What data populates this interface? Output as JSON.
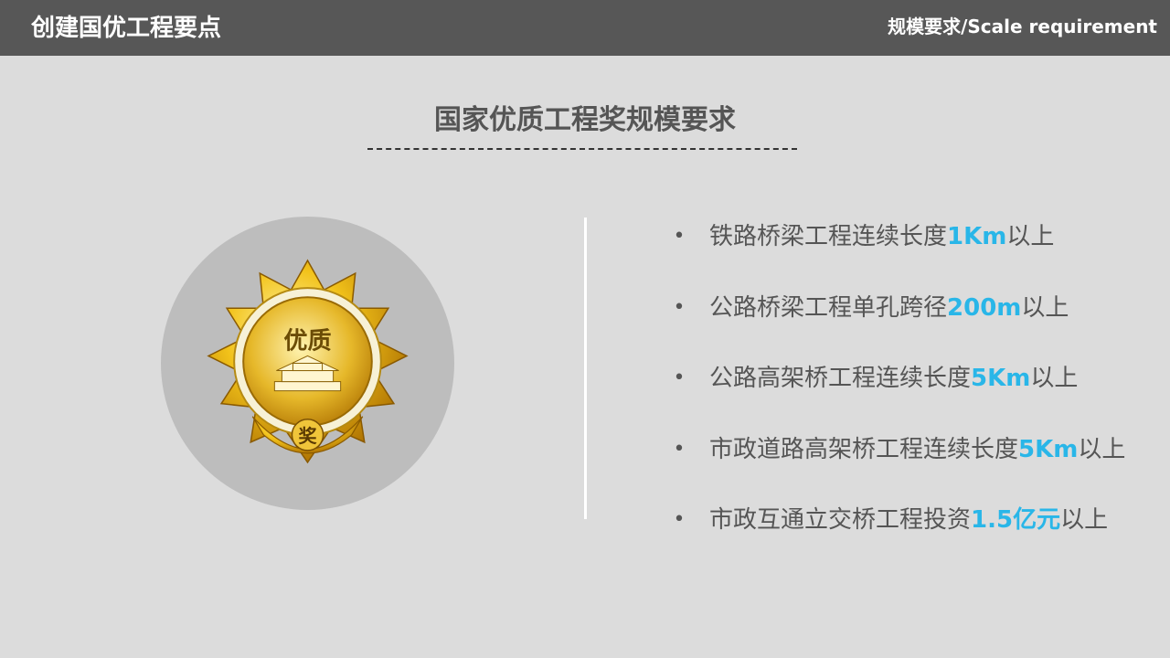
{
  "header": {
    "section_title": "创建国优工程要点",
    "page_label": "规模要求/Scale requirement"
  },
  "heading": "国家优质工程奖规模要求",
  "medal": {
    "top_text": "优质",
    "bottom_text": "奖",
    "icon": "gold-medal-icon"
  },
  "colors": {
    "highlight": "#29b6e8",
    "header_bg": "#575757",
    "background": "#dcdcdc"
  },
  "requirements": [
    {
      "prefix": "铁路桥梁工程连续长度",
      "value": "1Km",
      "suffix": "以上"
    },
    {
      "prefix": "公路桥梁工程单孔跨径",
      "value": "200m",
      "suffix": "以上"
    },
    {
      "prefix": "公路高架桥工程连续长度",
      "value": "5Km",
      "suffix": "以上"
    },
    {
      "prefix": "市政道路高架桥工程连续长度",
      "value": "5Km",
      "suffix": "以上"
    },
    {
      "prefix": "市政互通立交桥工程投资",
      "value": "1.5亿元",
      "suffix": "以上"
    }
  ]
}
